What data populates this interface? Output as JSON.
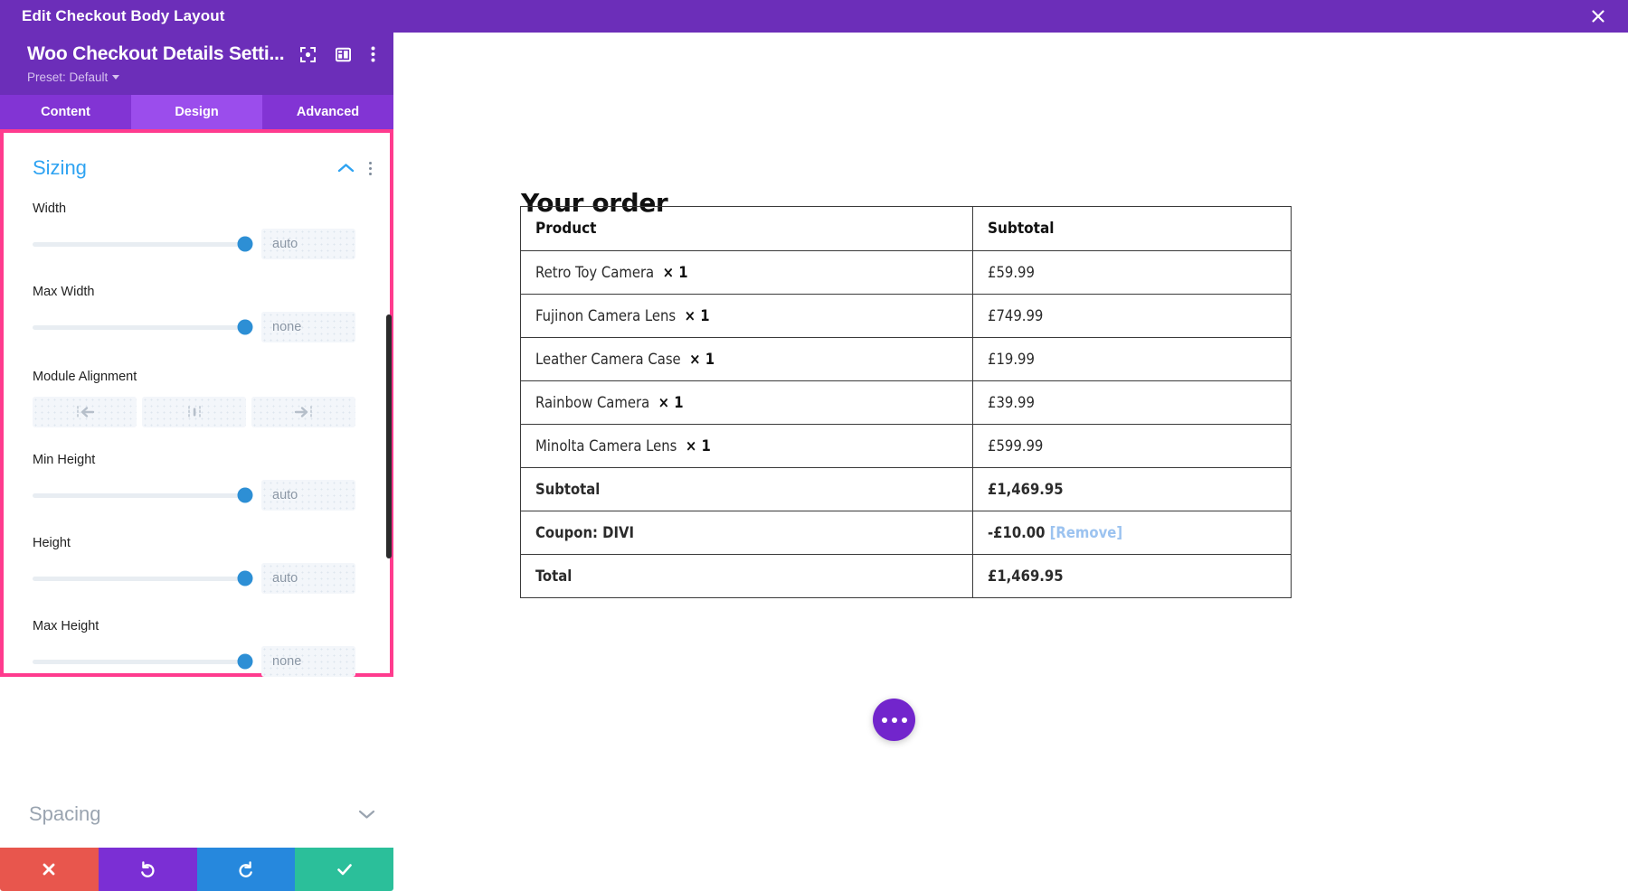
{
  "window": {
    "title": "Edit Checkout Body Layout",
    "close_icon": "close-icon"
  },
  "panel": {
    "module_title": "Woo Checkout Details Setti...",
    "preset_label": "Preset: Default",
    "header_icons": [
      "focus-target-icon",
      "layout-panel-icon",
      "vertical-dots-icon"
    ],
    "tabs": [
      {
        "label": "Content",
        "active": false
      },
      {
        "label": "Design",
        "active": true
      },
      {
        "label": "Advanced",
        "active": false
      }
    ],
    "section": {
      "title": "Sizing",
      "collapse_icon": "chevron-up-icon",
      "options_icon": "vertical-dots-icon",
      "fields": [
        {
          "label": "Width",
          "value": "",
          "placeholder": "auto",
          "slider_pct": 100
        },
        {
          "label": "Max Width",
          "value": "",
          "placeholder": "none",
          "slider_pct": 100
        },
        {
          "label": "Min Height",
          "value": "",
          "placeholder": "auto",
          "slider_pct": 100
        },
        {
          "label": "Height",
          "value": "",
          "placeholder": "auto",
          "slider_pct": 100
        },
        {
          "label": "Max Height",
          "value": "",
          "placeholder": "none",
          "slider_pct": 100
        }
      ],
      "alignment": {
        "label": "Module Alignment",
        "options": [
          "align-left-icon",
          "align-center-icon",
          "align-right-icon"
        ]
      }
    },
    "collapsed_section": {
      "title": "Spacing",
      "expand_icon": "chevron-down-icon"
    },
    "actions": [
      {
        "name": "cancel-button",
        "icon": "x-icon",
        "color": "#E8564D"
      },
      {
        "name": "undo-button",
        "icon": "undo-icon",
        "color": "#7B2FD4"
      },
      {
        "name": "redo-button",
        "icon": "redo-icon",
        "color": "#2688DD"
      },
      {
        "name": "save-button",
        "icon": "check-icon",
        "color": "#2BBF9A"
      }
    ]
  },
  "preview": {
    "heading": "Your order",
    "table": {
      "columns": [
        "Product",
        "Subtotal"
      ],
      "items": [
        {
          "product": "Retro Toy Camera",
          "qty": "1",
          "subtotal": "£59.99"
        },
        {
          "product": "Fujinon Camera Lens",
          "qty": "1",
          "subtotal": "£749.99"
        },
        {
          "product": "Leather Camera Case",
          "qty": "1",
          "subtotal": "£19.99"
        },
        {
          "product": "Rainbow Camera",
          "qty": "1",
          "subtotal": "£39.99"
        },
        {
          "product": "Minolta Camera Lens",
          "qty": "1",
          "subtotal": "£599.99"
        }
      ],
      "summary": [
        {
          "label": "Subtotal",
          "value": "£1,469.95",
          "link": ""
        },
        {
          "label": "Coupon: DIVI",
          "value": "-£10.00",
          "link": "[Remove]"
        },
        {
          "label": "Total",
          "value": "£1,469.95",
          "link": ""
        }
      ]
    },
    "fab_icon": "more-options-icon"
  },
  "colors": {
    "titlebar": "#6C2EB9",
    "tab_active": "#9B4DEC",
    "tab_inactive": "#8234D4",
    "highlight_border": "#FF3B8E",
    "section_title": "#2EA3F2",
    "slider_knob": "#2D8FD5",
    "remove_link": "#9CC3F0",
    "fab": "#7225CC"
  }
}
